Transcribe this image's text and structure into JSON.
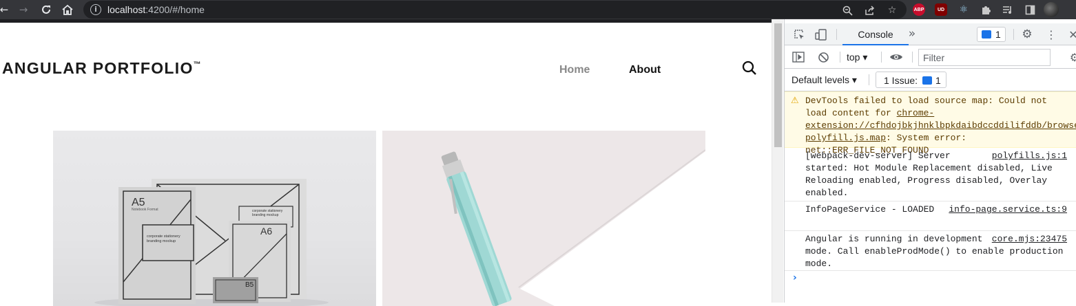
{
  "browser": {
    "url_host": "localhost",
    "url_path": ":4200/#/home",
    "extensions": [
      "ABP",
      "UD"
    ]
  },
  "site": {
    "brand": "ANGULAR PORTFOLIO",
    "brand_mark": "™",
    "nav": {
      "home": "Home",
      "about": "About"
    }
  },
  "mockup": {
    "a5": "A5",
    "a5_sub": "Notebook Format",
    "text1": "corporate stationery branding mockup",
    "text2": "corporate stationery branding mockup",
    "a6": "A6",
    "b5": "B5"
  },
  "devtools": {
    "tab_console": "Console",
    "more": "»",
    "messages_count": "1",
    "context": "top",
    "filter_placeholder": "Filter",
    "levels": "Default levels",
    "issues_label": "1 Issue:",
    "issues_count": "1",
    "logs": [
      {
        "type": "warning",
        "before": "DevTools failed to load source map: Could not load content for ",
        "link": "chrome-extension://cfhdojbkjhnklbpkdaibdccddilifddb/browser-polyfill.js.map",
        "after": ": System error: net::ERR_FILE_NOT_FOUND"
      },
      {
        "type": "info",
        "text": "[webpack-dev-server] Server started: Hot Module Replacement disabled, Live Reloading enabled, Progress disabled, Overlay enabled.",
        "source": "polyfills.js:1"
      },
      {
        "type": "info",
        "text": "InfoPageService - LOADED",
        "source": "info-page.service.ts:9"
      },
      {
        "type": "info",
        "text": "Angular is running in development mode. Call enableProdMode() to enable production mode.",
        "source": "core.mjs:23475"
      }
    ],
    "prompt": "›"
  }
}
